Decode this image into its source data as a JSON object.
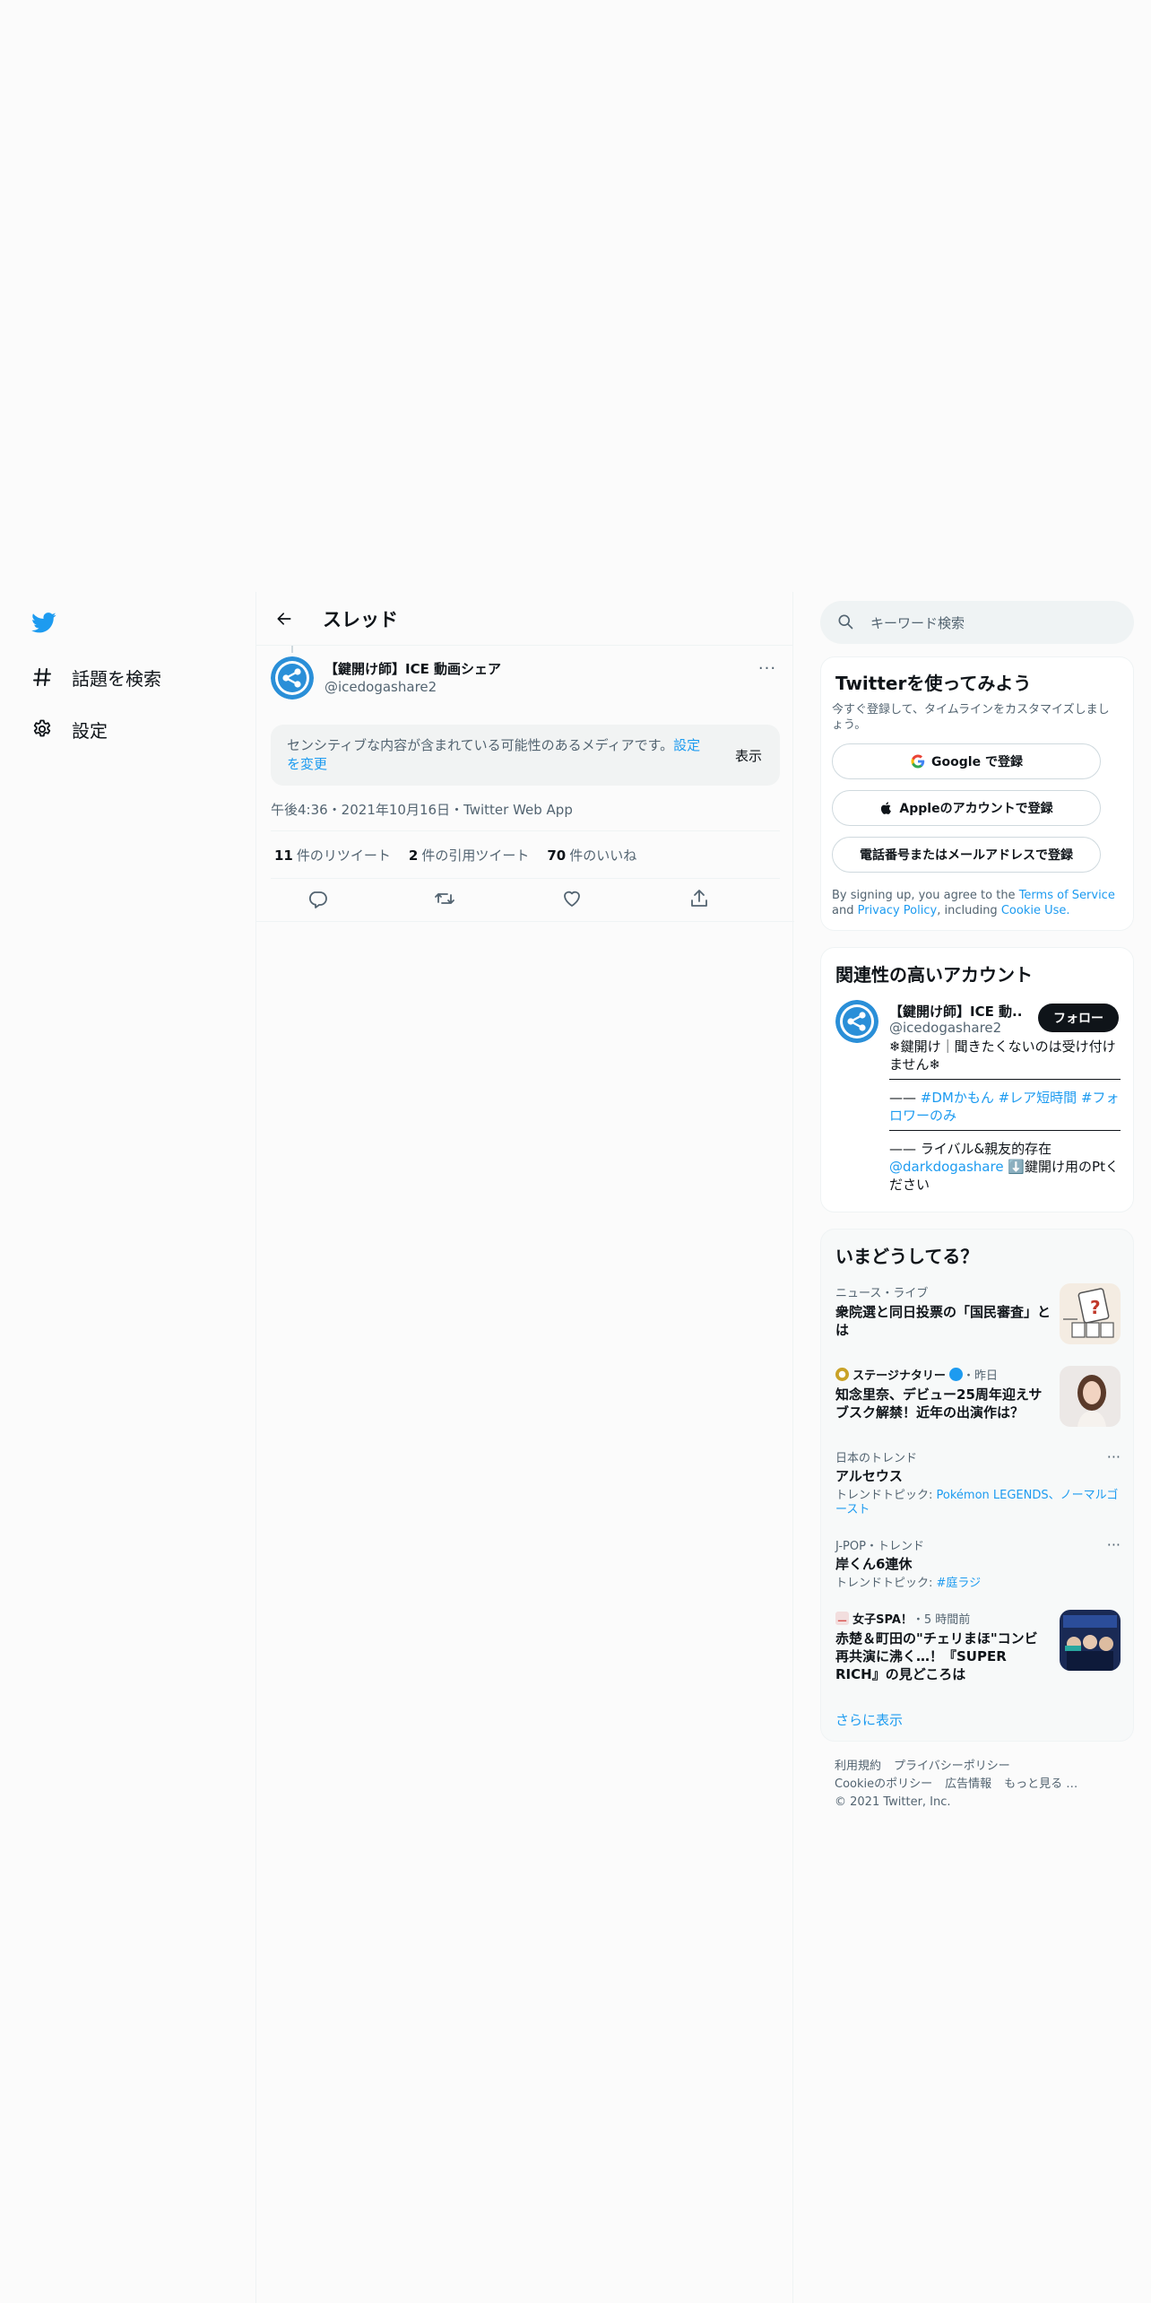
{
  "colors": {
    "accent": "#1d9bf0",
    "text": "#0f1419",
    "muted": "#536471"
  },
  "nav": {
    "logo_icon": "twitter-bird-icon",
    "items": [
      {
        "icon": "hashtag-icon",
        "label": "話題を検索"
      },
      {
        "icon": "gear-icon",
        "label": "設定"
      }
    ]
  },
  "thread": {
    "title": "スレッド",
    "author": {
      "name": "【鍵開け師】ICE 動画シェア",
      "handle": "@icedogashare2"
    },
    "more": "···",
    "sensitive": {
      "text": "センシティブな内容が含まれている可能性のあるメディアです。",
      "link": "設定を変更",
      "show": "表示"
    },
    "meta": "午後4:36・2021年10月16日・Twitter Web App",
    "stats": [
      {
        "count": "11",
        "label": "件のリツイート"
      },
      {
        "count": "2",
        "label": "件の引用ツイート"
      },
      {
        "count": "70",
        "label": "件のいいね"
      }
    ],
    "actions": [
      "reply-icon",
      "retweet-icon",
      "like-icon",
      "share-icon"
    ]
  },
  "search": {
    "placeholder": "キーワード検索"
  },
  "signup": {
    "title": "Twitterを使ってみよう",
    "sub": "今すぐ登録して、タイムラインをカスタマイズしましょう。",
    "google": "Google で登録",
    "apple": "Appleのアカウントで登録",
    "phone": "電話番号またはメールアドレスで登録",
    "terms_prefix": "By signing up, you agree to the",
    "tos": "Terms of Service",
    "and": "and",
    "privacy": "Privacy Policy",
    "including": ", including",
    "cookie": "Cookie Use."
  },
  "who": {
    "title": "関連性の高いアカウント",
    "name": "【鍵開け師】ICE 動...",
    "handle": "@icedogashare2",
    "follow": "フォロー",
    "bio1": "❄鍵開け｜聞きたくないのは受け付けません❄",
    "bio2_prefix": "—— ",
    "bio2_tags": "#DMかもん #レア短時間 #フォロワーのみ",
    "bio3_prefix": "—— ライバル&親友的存在",
    "bio3_mention": "@darkdogashare",
    "bio3_suffix": "⬇️鍵開け用のPtください"
  },
  "trends": {
    "title": "いまどうしてる？",
    "items": [
      {
        "ctx": "ニュース・ライブ",
        "title": "衆院選と同日投票の「国民審査」とは"
      },
      {
        "source": "ステージナタリー",
        "time": "・昨日",
        "title": "知念里奈、デビュー25周年迎えサブスク解禁！近年の出演作は？"
      },
      {
        "ctx": "日本のトレンド",
        "title": "アルセウス",
        "sub_label": "トレンドトピック: ",
        "sub_link": "Pokémon LEGENDS、ノーマルゴースト"
      },
      {
        "ctx": "J-POP・トレンド",
        "title": "岸くん6連休",
        "sub_label": "トレンドトピック: ",
        "sub_link": "#庭ラジ"
      },
      {
        "source": "女子SPA！",
        "time": "・5 時間前",
        "title": "赤楚＆町田の\"チェリまほ\"コンビ再共演に沸く…！『SUPER RICH』の見どころは"
      }
    ],
    "show_more": "さらに表示"
  },
  "footer": {
    "links": [
      "利用規約",
      "プライバシーポリシー",
      "Cookieのポリシー",
      "広告情報",
      "もっと見る …"
    ],
    "copyright": "© 2021 Twitter, Inc."
  }
}
